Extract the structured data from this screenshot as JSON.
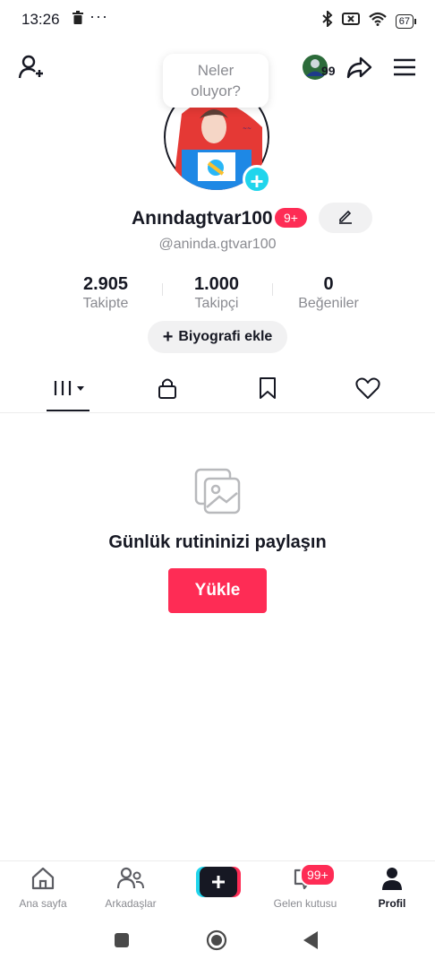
{
  "status_bar": {
    "time": "13:26",
    "dots": "···",
    "battery": "67"
  },
  "top_bar": {
    "story_count": "99"
  },
  "bubble": {
    "line1": "Neler",
    "line2": "oluyor?"
  },
  "profile": {
    "username": "Anındagtvar100",
    "notification_count": "9+",
    "handle": "@aninda.gtvar100"
  },
  "stats": [
    {
      "value": "2.905",
      "label": "Takipte"
    },
    {
      "value": "1.000",
      "label": "Takipçi"
    },
    {
      "value": "0",
      "label": "Beğeniler"
    }
  ],
  "bio_button": {
    "label": "Biyografi ekle"
  },
  "tabs": [
    {
      "icon": "grid-icon",
      "active": true
    },
    {
      "icon": "lock-icon",
      "active": false
    },
    {
      "icon": "bookmark-icon",
      "active": false
    },
    {
      "icon": "heart-icon",
      "active": false
    }
  ],
  "empty_state": {
    "title": "Günlük rutininizi paylaşın",
    "button": "Yükle"
  },
  "bottom_nav": {
    "home": "Ana sayfa",
    "friends": "Arkadaşlar",
    "inbox": "Gelen kutusu",
    "inbox_badge": "99+",
    "profile": "Profil"
  },
  "colors": {
    "accent": "#fe2c55",
    "cyan": "#20d5ec",
    "text": "#161823",
    "muted": "#8a8b91"
  }
}
